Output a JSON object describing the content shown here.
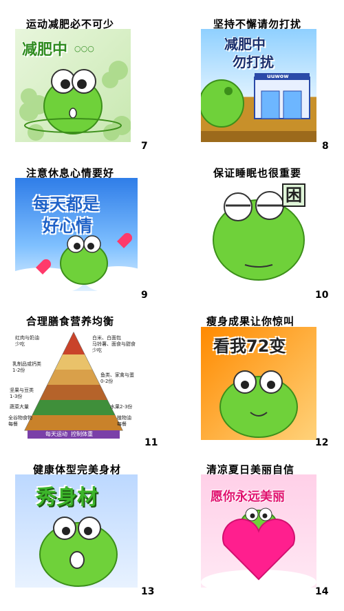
{
  "items": [
    {
      "caption": "运动减肥必不可少",
      "number": "7",
      "banner": "减肥中",
      "banner_suffix": "○○○"
    },
    {
      "caption": "坚持不懈请勿打扰",
      "number": "8",
      "banner": "减肥中",
      "banner_line2": "勿打扰",
      "shop_sign": "uuwow"
    },
    {
      "caption": "注意休息心情要好",
      "number": "9",
      "banner": "每天都是",
      "banner_line2": "好心情"
    },
    {
      "caption": "保证睡眠也很重要",
      "number": "10",
      "banner": "困"
    },
    {
      "caption": "合理膳食营养均衡",
      "number": "11",
      "pyramid_labels": [
        "红肉与奶油\n少吃",
        "白米、白面包\n马铃薯、面食与甜食\n少吃",
        "乳制品或钙类\n1-2份",
        "鱼类、家禽与蛋\n0-2份",
        "坚果与豆类\n1-3份",
        "蔬菜大量",
        "水果2-3份",
        "全谷物食物\n每餐",
        "植物油\n每餐",
        "每天运动  控制体重"
      ]
    },
    {
      "caption": "瘦身成果让你惊叫",
      "number": "12",
      "banner": "看我72变"
    },
    {
      "caption": "健康体型完美身材",
      "number": "13",
      "banner": "秀身材"
    },
    {
      "caption": "清凉夏日美丽自信",
      "number": "14",
      "banner": "愿你永远美丽"
    }
  ]
}
